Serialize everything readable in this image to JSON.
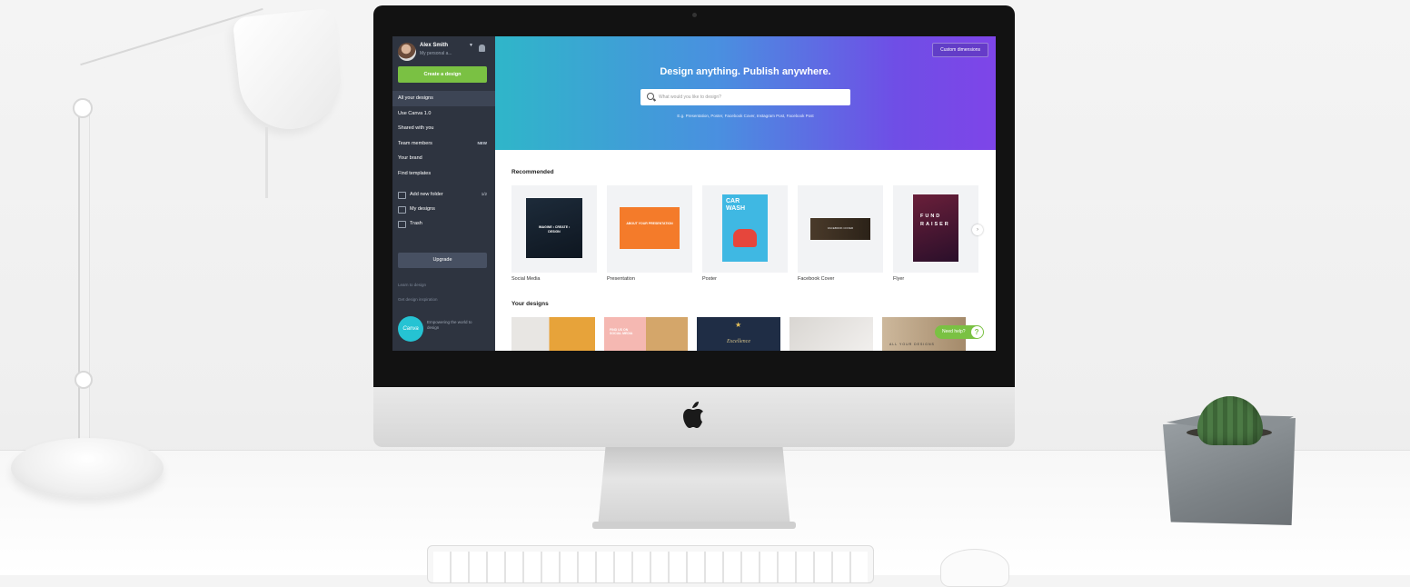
{
  "colors": {
    "sidebar_bg": "#2e3440",
    "accent_green": "#7ac143",
    "hero_gradient_start": "#2fb6c9",
    "hero_gradient_end": "#7e45e8"
  },
  "sidebar": {
    "user_name": "Alex Smith",
    "user_subtitle": "My personal a...",
    "create_button": "Create a design",
    "nav": [
      {
        "label": "All your designs",
        "active": true,
        "badge": ""
      },
      {
        "label": "Use Canva 1.0",
        "active": false,
        "badge": ""
      },
      {
        "label": "Shared with you",
        "active": false,
        "badge": ""
      },
      {
        "label": "Team members",
        "active": false,
        "badge": "NEW"
      },
      {
        "label": "Your brand",
        "active": false,
        "badge": ""
      },
      {
        "label": "Find templates",
        "active": false,
        "badge": ""
      }
    ],
    "folders": [
      {
        "label": "Add new folder",
        "icon": "folder-plus-icon",
        "count": "1/2"
      },
      {
        "label": "My designs",
        "icon": "folder-icon",
        "count": ""
      },
      {
        "label": "Trash",
        "icon": "trash-icon",
        "count": ""
      }
    ],
    "upgrade_button": "Upgrade",
    "links": [
      "Learn to design",
      "Get design inspiration"
    ],
    "logo_text": "Canva",
    "promo_text": "Empowering the world to design"
  },
  "hero": {
    "custom_dimensions": "Custom dimensions",
    "title": "Design anything. Publish anywhere.",
    "search_placeholder": "What would you like to design?",
    "examples": "E.g. Presentation, Poster, Facebook Cover, Instagram Post, Facebook Post"
  },
  "recommended": {
    "title": "Recommended",
    "items": [
      {
        "label": "Social Media",
        "thumb_text": "IMAGINE • CREATE • DESIGN"
      },
      {
        "label": "Presentation",
        "thumb_text": "ABOUT YOUR PRESENTATION"
      },
      {
        "label": "Poster",
        "thumb_text": "CAR WASH"
      },
      {
        "label": "Facebook Cover",
        "thumb_text": "FACEBOOK COVER"
      },
      {
        "label": "Flyer",
        "thumb_text": "FUND RAISER"
      }
    ]
  },
  "your_designs": {
    "title": "Your designs",
    "items": [
      "",
      "FIND US ON SOCIAL MEDIA",
      "Excellence",
      "",
      "ALL YOUR DESIGNS"
    ]
  },
  "help_button": "Need help?"
}
